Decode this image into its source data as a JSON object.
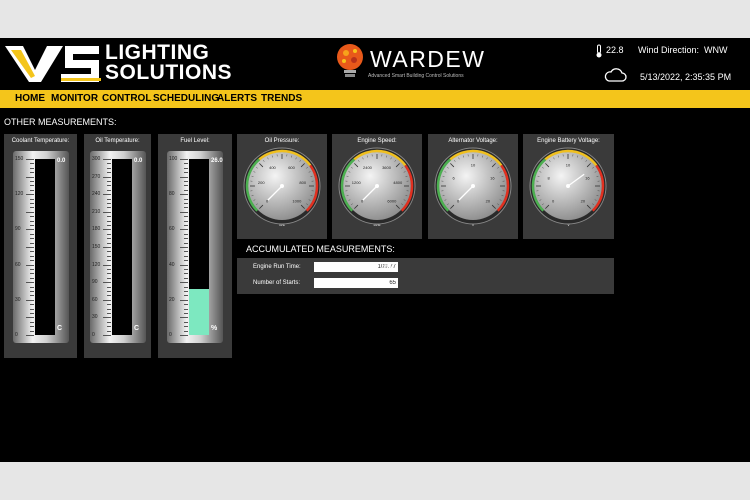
{
  "header": {
    "brand_line1": "LIGHTING",
    "brand_line2": "SOLUTIONS",
    "wardew_title": "WARDEW",
    "wardew_subtitle": "Advanced Smart Building Control Solutions",
    "temperature": "22.8",
    "wind_label": "Wind Direction:",
    "wind_value": "WNW",
    "datetime": "5/13/2022, 2:35:35 PM",
    "icons": [
      "thermometer-icon",
      "cloud-icon",
      "lightbulb-icon"
    ]
  },
  "nav": [
    "HOME",
    "MONITOR",
    "CONTROL",
    "SCHEDULING",
    "ALERTS",
    "TRENDS"
  ],
  "section_title": "OTHER MEASUREMENTS:",
  "tanks": [
    {
      "title": "Coolant Temperature:",
      "ticks": [
        "150",
        "120",
        "90",
        "60",
        "30",
        "0"
      ],
      "value": "0.0",
      "level": 0.0,
      "unit": "C"
    },
    {
      "title": "Oil Temperature:",
      "ticks": [
        "300",
        "270",
        "240",
        "210",
        "180",
        "150",
        "120",
        "90",
        "60",
        "30",
        "0"
      ],
      "value": "0.0",
      "level": 0.0,
      "unit": "C"
    },
    {
      "title": "Fuel Level:",
      "ticks": [
        "100",
        "80",
        "60",
        "40",
        "20",
        "0"
      ],
      "value": "26.0",
      "level": 0.26,
      "unit": "%"
    }
  ],
  "gauges": [
    {
      "title": "Oil Pressure:",
      "ticks": [
        "0",
        "200",
        "400",
        "600",
        "800",
        "1000"
      ],
      "value": "0.00",
      "unit": "kPa",
      "fraction": 0
    },
    {
      "title": "Engine Speed:",
      "ticks": [
        "0",
        "1200",
        "2400",
        "3600",
        "4800",
        "6000"
      ],
      "value": "0",
      "unit": "RPM",
      "fraction": 0
    },
    {
      "title": "Alternator Voltage:",
      "ticks": [
        "0",
        "6",
        "10",
        "16",
        "20"
      ],
      "value": "0",
      "unit": "V",
      "fraction": 0
    },
    {
      "title": "Engine Battery Voltage:",
      "ticks": [
        "0",
        "8",
        "10",
        "16",
        "20"
      ],
      "value": "14",
      "unit": "V",
      "fraction": 0.7
    }
  ],
  "accumulated": {
    "title": "ACCUMULATED MEASUREMENTS:",
    "run_time_label": "Engine Run Time:",
    "run_time_value": "109.77",
    "run_time_unit": "Hrs",
    "starts_label": "Number of Starts:",
    "starts_value": "65"
  },
  "colors": {
    "nav": "#f4c51b",
    "fuel": "#7de8c0",
    "panel": "#3a3a3a"
  }
}
